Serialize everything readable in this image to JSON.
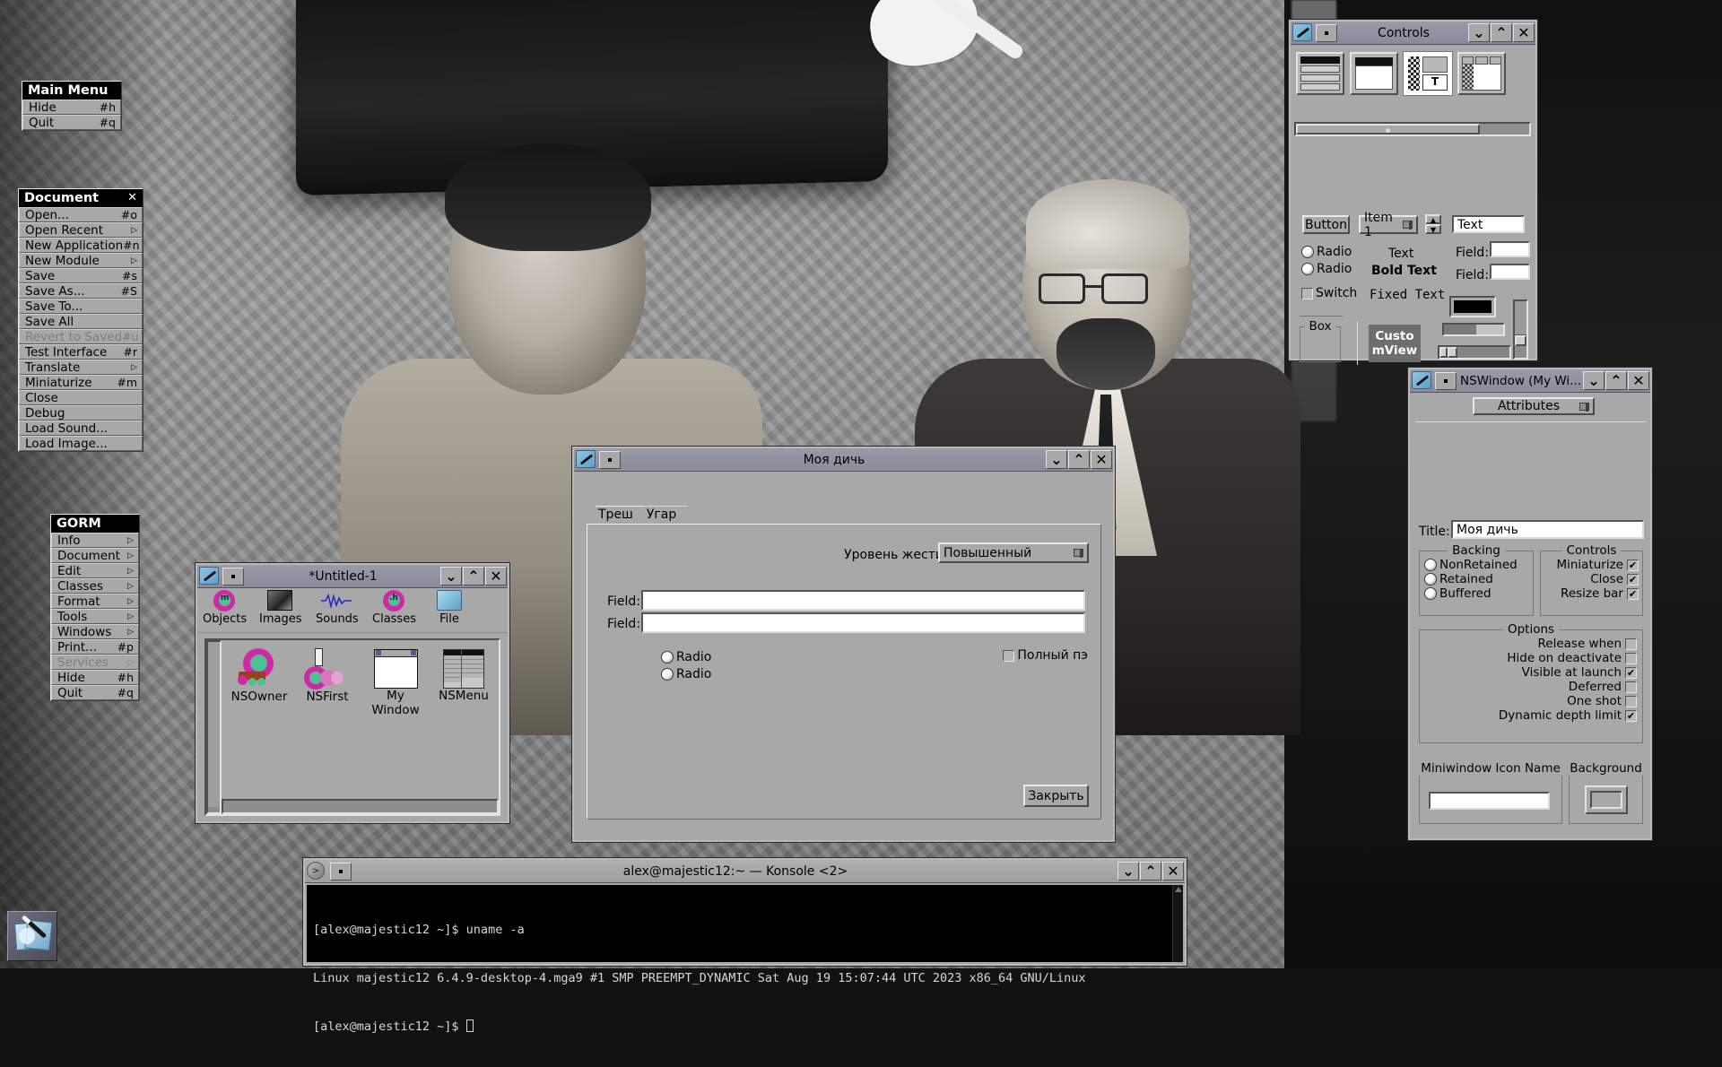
{
  "desktop": {
    "icon_label": "gorm-desktop-icon"
  },
  "main_menu": {
    "title": "Main Menu",
    "items": [
      {
        "label": "Hide",
        "key": "#h"
      },
      {
        "label": "Quit",
        "key": "#q"
      }
    ]
  },
  "document_menu": {
    "title": "Document",
    "close_glyph": "✕",
    "items": [
      {
        "label": "Open...",
        "key": "#o"
      },
      {
        "label": "Open Recent",
        "key": "▷"
      },
      {
        "label": "New Application",
        "key": "#n"
      },
      {
        "label": "New Module",
        "key": "▷"
      },
      {
        "label": "Save",
        "key": "#s"
      },
      {
        "label": "Save As...",
        "key": "#S"
      },
      {
        "label": "Save To...",
        "key": ""
      },
      {
        "label": "Save All",
        "key": ""
      },
      {
        "label": "Revert to Saved",
        "key": "#u",
        "disabled": true
      },
      {
        "label": "Test Interface",
        "key": "#r"
      },
      {
        "label": "Translate",
        "key": "▷"
      },
      {
        "label": "Miniaturize",
        "key": "#m"
      },
      {
        "label": "Close",
        "key": ""
      },
      {
        "label": "Debug",
        "key": ""
      },
      {
        "label": "Load Sound...",
        "key": ""
      },
      {
        "label": "Load Image...",
        "key": ""
      }
    ]
  },
  "gorm_menu": {
    "title": "GORM",
    "items": [
      {
        "label": "Info",
        "key": "▷"
      },
      {
        "label": "Document",
        "key": "▷"
      },
      {
        "label": "Edit",
        "key": "▷"
      },
      {
        "label": "Classes",
        "key": "▷"
      },
      {
        "label": "Format",
        "key": "▷"
      },
      {
        "label": "Tools",
        "key": "▷"
      },
      {
        "label": "Windows",
        "key": "▷"
      },
      {
        "label": "Print...",
        "key": "#p"
      },
      {
        "label": "Services",
        "key": "▷",
        "disabled": true
      },
      {
        "label": "Hide",
        "key": "#h"
      },
      {
        "label": "Quit",
        "key": "#q"
      }
    ]
  },
  "palette_window": {
    "title": "Controls",
    "minimize_glyph": "⌄",
    "maximize_glyph": "⌃",
    "close_glyph": "✕",
    "tabs": [
      "menus-palette",
      "windows-palette",
      "controls-palette",
      "containers-palette"
    ],
    "selected_tab": 2,
    "widgets": {
      "button": "Button",
      "popup": "Item 1",
      "textfield": "Text",
      "radio1": "Radio",
      "radio2": "Radio",
      "switch": "Switch",
      "text": "Text",
      "bold_text": "Bold Text",
      "fixed_text": "Fixed Text",
      "field_label_1": "Field:",
      "field_label_2": "Field:",
      "field_value_1": "",
      "field_value_2": "",
      "box": "Box",
      "custom_view": "Custo\nmView"
    }
  },
  "inspector": {
    "title": "NSWindow (My Wi...",
    "minimize_glyph": "⌄",
    "maximize_glyph": "⌃",
    "close_glyph": "✕",
    "section_popup": "Attributes",
    "title_label": "Title:",
    "title_value": "Моя дичь",
    "backing": {
      "legend": "Backing",
      "options": [
        "NonRetained",
        "Retained",
        "Buffered"
      ],
      "selected": 2
    },
    "controls": {
      "legend": "Controls",
      "options": [
        {
          "label": "Miniaturize",
          "checked": true
        },
        {
          "label": "Close",
          "checked": true
        },
        {
          "label": "Resize bar",
          "checked": true
        }
      ]
    },
    "options": {
      "legend": "Options",
      "items": [
        {
          "label": "Release when",
          "checked": false
        },
        {
          "label": "Hide on deactivate",
          "checked": false
        },
        {
          "label": "Visible at launch",
          "checked": true
        },
        {
          "label": "Deferred",
          "checked": false
        },
        {
          "label": "One shot",
          "checked": false
        },
        {
          "label": "Dynamic depth limit",
          "checked": true
        }
      ]
    },
    "miniwindow": {
      "legend": "Miniwindow Icon Name",
      "value": ""
    },
    "background": {
      "legend": "Background"
    }
  },
  "dialog": {
    "title": "Моя дичь",
    "minimize_glyph": "⌄",
    "maximize_glyph": "⌃",
    "close_glyph": "✕",
    "tabs": [
      {
        "label": "Треш",
        "selected": true
      },
      {
        "label": "Угар",
        "selected": false
      }
    ],
    "popup_label": "Уровень жести",
    "popup_value": "Повышенный",
    "field1_label": "Field:",
    "field1_value": "",
    "field2_label": "Field:",
    "field2_value": "",
    "radio1": "Radio",
    "radio2": "Radio",
    "checkbox_label": "Полный пэ",
    "checkbox_checked": false,
    "close_button": "Закрыть"
  },
  "gorm_doc": {
    "title": "*Untitled-1",
    "minimize_glyph": "⌄",
    "maximize_glyph": "⌃",
    "close_glyph": "✕",
    "toolbar": [
      {
        "label": "Objects",
        "icon": "objects-icon"
      },
      {
        "label": "Images",
        "icon": "images-icon"
      },
      {
        "label": "Sounds",
        "icon": "sounds-icon"
      },
      {
        "label": "Classes",
        "icon": "classes-icon"
      },
      {
        "label": "File",
        "icon": "file-icon"
      }
    ],
    "selected_toolbar": 0,
    "objects": [
      {
        "label": "NSOwner",
        "icon": "nsowner-icon"
      },
      {
        "label": "NSFirst",
        "icon": "nsfirst-icon"
      },
      {
        "label": "My Window",
        "icon": "window-icon"
      },
      {
        "label": "NSMenu",
        "icon": "nsmenu-icon"
      }
    ]
  },
  "konsole": {
    "title": "alex@majestic12:~ — Konsole <2>",
    "minimize_glyph": "⌄",
    "maximize_glyph": "⌃",
    "close_glyph": "✕",
    "lines": [
      "[alex@majestic12 ~]$ uname -a",
      "Linux majestic12 6.4.9-desktop-4.mga9 #1 SMP PREEMPT_DYNAMIC Sat Aug 19 15:07:44 UTC 2023 x86_64 GNU/Linux",
      "[alex@majestic12 ~]$ "
    ],
    "colors": {
      "bg": "#000000",
      "fg": "#d6d6d6"
    }
  }
}
